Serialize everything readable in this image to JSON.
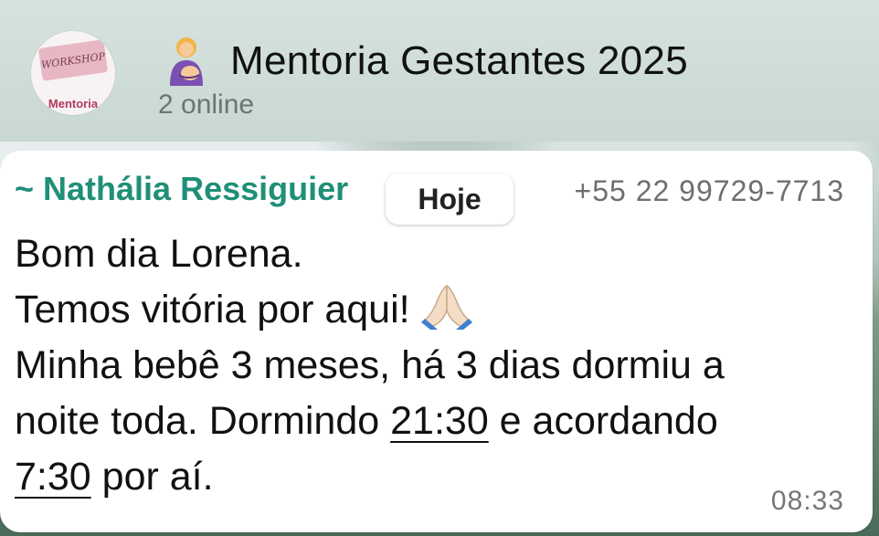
{
  "header": {
    "avatar_label": "WORKSHOP",
    "avatar_subtitle": "Mentoria",
    "group_icon": "pregnant-person-with-baby-emoji",
    "title": "Mentoria Gestantes 2025",
    "status": "2 online"
  },
  "date_chip": "Hoje",
  "message": {
    "sender": "~ Nathália Ressiguier",
    "phone": "+55 22 99729-7713",
    "line1": "Bom dia Lorena.",
    "line2": "Temos vitória por aqui!",
    "line2_icon": "praying-hands-emoji",
    "line3": "Minha bebê 3 meses, há 3 dias dormiu a",
    "line4_pre": "noite toda. Dormindo ",
    "time_1": "21:30",
    "line4_post": " e acordando",
    "time_2": "7:30",
    "line5_post": " por aí.",
    "timestamp": "08:33"
  },
  "colors": {
    "sender": "#1f8f78",
    "bubble": "#ffffff",
    "header_bg": "#d6e2de"
  }
}
